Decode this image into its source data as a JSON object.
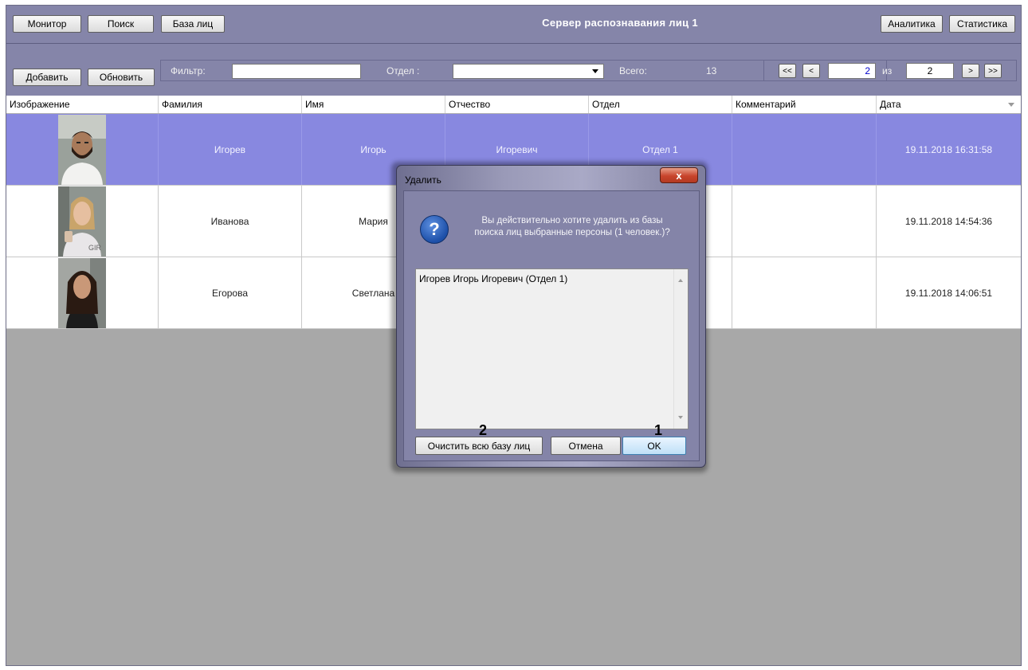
{
  "toolbar": {
    "monitor": "Монитор",
    "search": "Поиск",
    "facebase": "База лиц",
    "analytics": "Аналитика",
    "statistics": "Статистика",
    "server_title": "Сервер распознавания лиц 1"
  },
  "actions": {
    "add": "Добавить",
    "refresh": "Обновить",
    "filter_label": "Фильтр:",
    "filter_value": "",
    "dept_label": "Отдел :",
    "dept_value": "",
    "total_label": "Всего:",
    "total_value": "13"
  },
  "pager": {
    "first": "<<",
    "prev": "<",
    "current": "2",
    "of_label": "из",
    "total": "2",
    "next": ">",
    "last": ">>"
  },
  "table": {
    "columns": [
      "Изображение",
      "Фамилия",
      "Имя",
      "Отчество",
      "Отдел",
      "Комментарий",
      "Дата"
    ],
    "rows": [
      {
        "last": "Игорев",
        "first": "Игорь",
        "middle": "Игоревич",
        "dept": "Отдел 1",
        "comment": "",
        "date": "19.11.2018 16:31:58"
      },
      {
        "last": "Иванова",
        "first": "Мария",
        "middle": "",
        "dept": "",
        "comment": "",
        "date": "19.11.2018 14:54:36"
      },
      {
        "last": "Егорова",
        "first": "Светлана",
        "middle": "",
        "dept": "",
        "comment": "",
        "date": "19.11.2018 14:06:51"
      }
    ]
  },
  "dialog": {
    "title": "Удалить",
    "close_glyph": "x",
    "message_line1": "Вы действительно хотите удалить из базы",
    "message_line2": "поиска лиц выбранные персоны (1 человек.)?",
    "list_item": "Игорев Игорь Игоревич (Отдел 1)",
    "clear_all": "Очистить всю базу лиц",
    "cancel": "Отмена",
    "ok": "OK",
    "marker_ok": "1",
    "marker_clear": "2"
  },
  "colors": {
    "toolbar_bg": "#8585a9",
    "selected_row": "#8888e0",
    "workspace_bg": "#a8a8a8"
  }
}
